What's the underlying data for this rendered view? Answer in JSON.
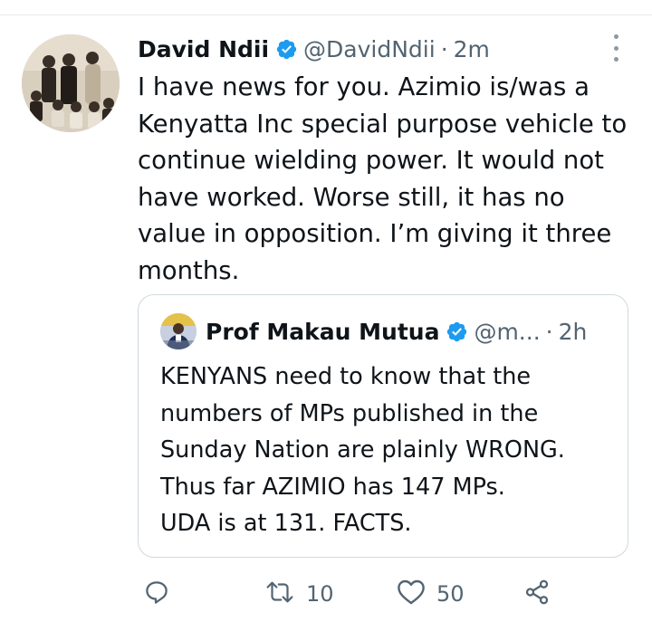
{
  "tweet": {
    "author_name": "David Ndii",
    "handle": "@DavidNdii",
    "separator": "·",
    "time": "2m",
    "text": "I have news for you. Azimio is/was a\nKenyatta Inc special purpose vehicle to\ncontinue wielding power. It would not\nhave worked. Worse still, it has no\nvalue in opposition. I’m giving it three\nmonths.",
    "verified": true,
    "verified_color": "#1d9bf0"
  },
  "quote": {
    "author_name": "Prof Makau Mutua",
    "handle": "@m...",
    "separator": "·",
    "time": "2h",
    "text": "KENYANS need to know that the\nnumbers of MPs published in the\nSunday Nation are plainly WRONG.\nThus far AZIMIO has 147 MPs.\nUDA is at 131.  FACTS.",
    "verified": true
  },
  "actions": {
    "reply_icon": "reply-icon",
    "retweet_icon": "retweet-icon",
    "retweet_count": "10",
    "like_icon": "heart-icon",
    "like_count": "50",
    "share_icon": "share-icon"
  },
  "colors": {
    "text": "#0f1419",
    "secondary": "#536471",
    "border": "#cfd9de"
  }
}
